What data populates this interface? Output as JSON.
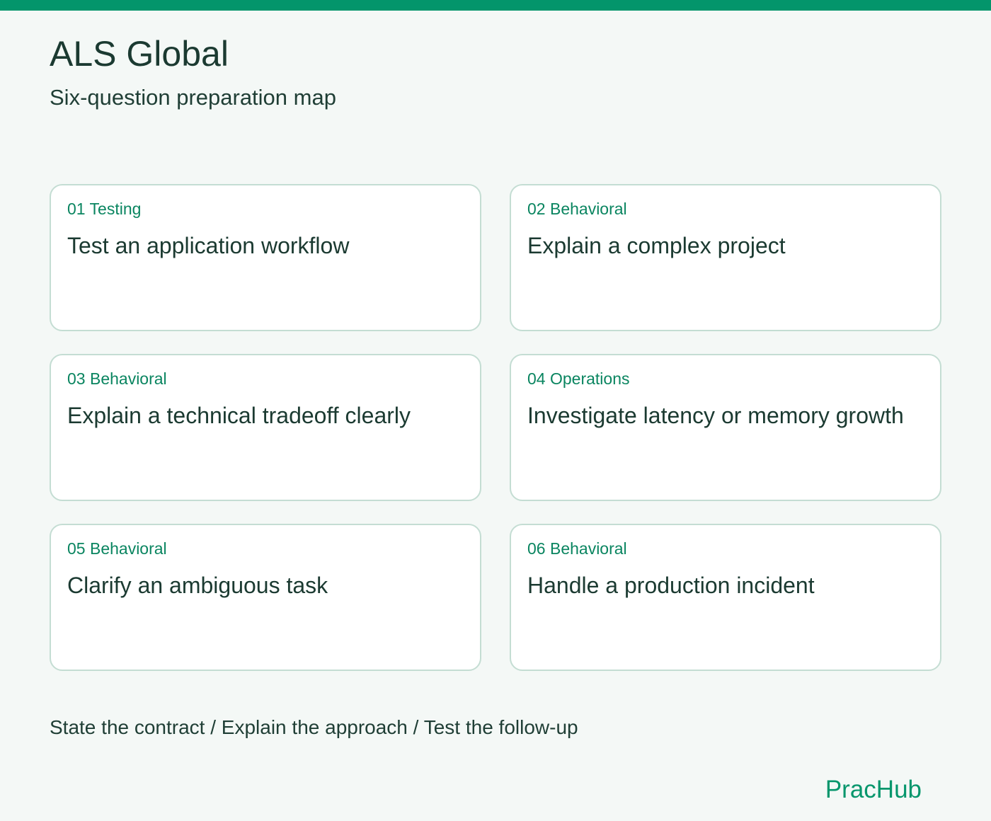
{
  "colors": {
    "accent": "#03956b",
    "label": "#0a8560",
    "text": "#1b3a31",
    "background": "#f4f8f6",
    "card_border": "#c4ddd3"
  },
  "header": {
    "title": "ALS Global",
    "subtitle": "Six-question preparation map"
  },
  "cards": [
    {
      "label": "01 Testing",
      "title": "Test an application workflow"
    },
    {
      "label": "02 Behavioral",
      "title": "Explain a complex project"
    },
    {
      "label": "03 Behavioral",
      "title": "Explain a technical tradeoff clearly"
    },
    {
      "label": "04 Operations",
      "title": "Investigate latency or memory growth"
    },
    {
      "label": "05 Behavioral",
      "title": "Clarify an ambiguous task"
    },
    {
      "label": "06 Behavioral",
      "title": "Handle a production incident"
    }
  ],
  "footer": {
    "steps": "State the contract / Explain the approach / Test the follow-up"
  },
  "brand": {
    "name": "PracHub"
  }
}
